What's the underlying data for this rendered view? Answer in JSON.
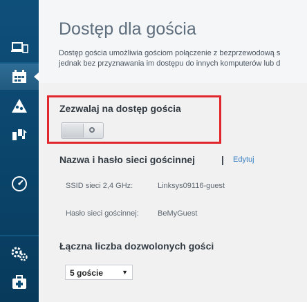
{
  "sidebar": {
    "items": [
      {
        "icon": "devices-icon"
      },
      {
        "icon": "guest-access-icon",
        "active": true
      },
      {
        "icon": "parental-controls-icon"
      },
      {
        "icon": "media-prioritization-icon"
      },
      {
        "icon": "speed-test-icon"
      },
      {
        "icon": "settings-icon"
      },
      {
        "icon": "troubleshooting-icon"
      }
    ]
  },
  "page": {
    "title": "Dostęp dla gościa",
    "description_line1": "Dostęp gościa umożliwia gościom połączenie z bezprzewodową s",
    "description_line2": "jednak bez przyznawania im dostępu do innych komputerów lub d"
  },
  "guest_access": {
    "label": "Zezwalaj na dostęp gościa",
    "enabled": false
  },
  "network": {
    "heading": "Nazwa i hasło sieci gościnnej",
    "separator": "|",
    "edit_label": "Edytuj",
    "ssid_label": "SSID sieci 2,4 GHz:",
    "ssid_value": "Linksys09116-guest",
    "password_label": "Hasło sieci gościnnej:",
    "password_value": "BeMyGuest"
  },
  "guests": {
    "heading": "Łączna liczba dozwolonych gości",
    "selected": "5 goście"
  },
  "colors": {
    "sidebar": "#0a4369",
    "highlight": "#e0252b",
    "link": "#3b7fc4"
  }
}
